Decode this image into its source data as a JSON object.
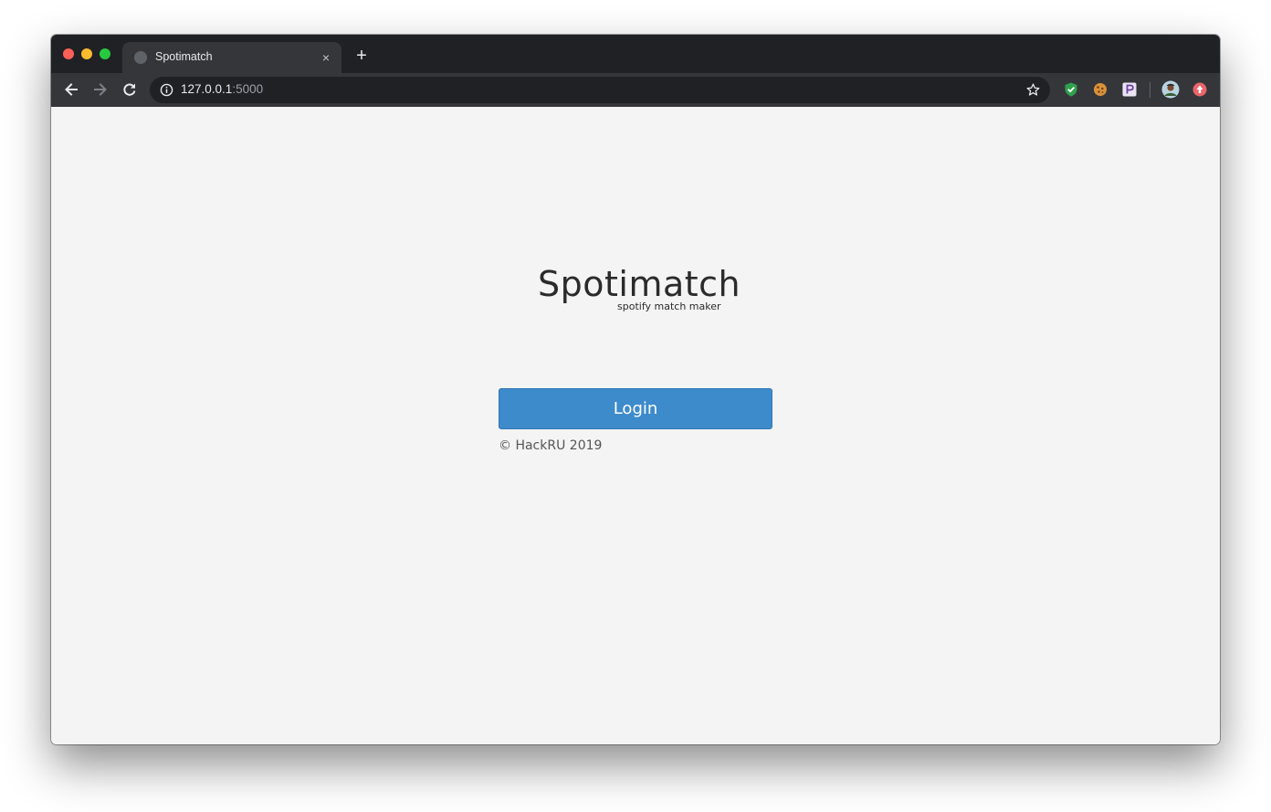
{
  "browser": {
    "tab": {
      "title": "Spotimatch",
      "favicon": "globe-icon",
      "close": "×"
    },
    "new_tab": "+",
    "toolbar": {
      "back": "arrow-left-icon",
      "forward": "arrow-right-icon",
      "reload": "reload-icon"
    },
    "omnibox": {
      "host": "127.0.0.1",
      "port": ":5000",
      "info_icon": "info-icon",
      "bookmark_icon": "star-icon"
    },
    "extensions": [
      "shield-check-icon",
      "cookie-icon",
      "p-extension-icon",
      "profile-avatar-icon",
      "alert-extension-icon"
    ]
  },
  "page": {
    "title": "Spotimatch",
    "subtitle": "spotify match maker",
    "login_label": "Login",
    "footer": "© HackRU 2019"
  },
  "colors": {
    "page_background": "#f4f4f4",
    "button_blue": "#3d8bcb",
    "tabstrip": "#202124",
    "toolbar": "#35363a"
  }
}
